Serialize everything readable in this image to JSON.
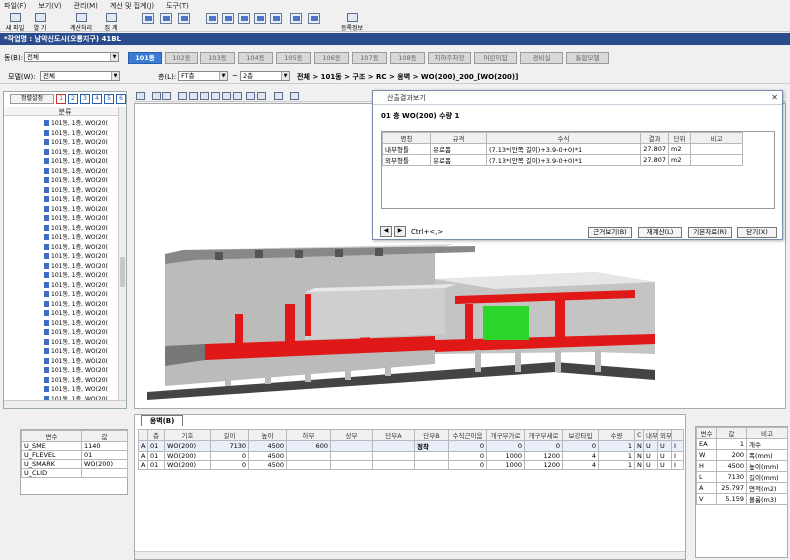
{
  "menu": [
    "파일(F)",
    "보기(V)",
    "관리(M)",
    "계산 및 집계(J)",
    "도구(T)"
  ],
  "toolbar": {
    "buttons": [
      "새 파일",
      "열 기",
      "계산처리",
      "집 계",
      "등록정보"
    ]
  },
  "title": "*작업명 : 남악신도시(오룡지구) 41BL",
  "building_label": "동(B):",
  "building_value": "전체",
  "tabs": [
    "101동",
    "102동",
    "103동",
    "104동",
    "105동",
    "106동",
    "107동",
    "108동",
    "지하주차장",
    "어린이집",
    "경비실",
    "통합모델"
  ],
  "model_label": "모델(W):",
  "model_value": "전체",
  "floor_label": "층(L):",
  "floor_from": "FT층",
  "floor_sep": "~",
  "floor_to": "2층",
  "breadcrumb": "전체 > 101동 > 구조 > RC > 옹벽 > WO(200)_200_[WO(200)]",
  "left": {
    "sort_label": "정렬설정",
    "nums": [
      "1",
      "2",
      "3",
      "4",
      "5",
      "6"
    ],
    "col_header": "분류",
    "item_text": "101동, 1층, WO(20("
  },
  "dialog": {
    "title": "산출결과보기",
    "heading": "01 층 WO(200)  수량 1",
    "columns": [
      "명칭",
      "규격",
      "수식",
      "결과",
      "단위",
      "비고"
    ],
    "rows": [
      [
        "내부형틀",
        "유로폼",
        "(7.13*(안쪽 길이)+3.9-0+0)*1",
        "27.807",
        "m2",
        ""
      ],
      [
        "외부형틀",
        "유로폼",
        "(7.13*(안쪽 길이)+3.9-0+0)*1",
        "27.807",
        "m2",
        ""
      ]
    ],
    "nav_hint": "Ctrl+<,>",
    "buttons": [
      "근거보기(B)",
      "재계산(L)",
      "기본자료(R)",
      "닫기(X)"
    ]
  },
  "vars": {
    "columns": [
      "변수",
      "값"
    ],
    "rows": [
      [
        "U_SME",
        "1140"
      ],
      [
        "U_FLEVEL",
        "01"
      ],
      [
        "U_SMARK",
        "WO(200)"
      ],
      [
        "U_CLID",
        ""
      ]
    ]
  },
  "bottom": {
    "tab": "옹벽(B)",
    "columns": [
      "",
      "층",
      "기호",
      "길이",
      "높이",
      "하부",
      "상부",
      "단부A",
      "단부B",
      "수직근이음",
      "개구부가로",
      "개구부세로",
      "보강타입",
      "수량",
      "C",
      "내부",
      "외부",
      ""
    ],
    "rows": [
      [
        "A",
        "01",
        "WO(200)",
        "7130",
        "4500",
        "600",
        "",
        "",
        "정착",
        "0",
        "0",
        "0",
        "0",
        "1",
        "N",
        "U",
        "U",
        "I"
      ],
      [
        "A",
        "01",
        "WO(200)",
        "0",
        "4500",
        "",
        "",
        "",
        "",
        "0",
        "1000",
        "1200",
        "4",
        "1",
        "N",
        "U",
        "U",
        "I"
      ],
      [
        "A",
        "01",
        "WO(200)",
        "0",
        "4500",
        "",
        "",
        "",
        "",
        "0",
        "1000",
        "1200",
        "4",
        "1",
        "N",
        "U",
        "U",
        "I"
      ]
    ]
  },
  "right": {
    "columns": [
      "변수",
      "값",
      "비고"
    ],
    "rows": [
      [
        "EA",
        "1",
        "개수"
      ],
      [
        "W",
        "200",
        "폭(mm)"
      ],
      [
        "H",
        "4500",
        "높이(mm)"
      ],
      [
        "L",
        "7130",
        "길이(mm)"
      ],
      [
        "A",
        "25.797",
        "면적(m2)"
      ],
      [
        "V",
        "5.159",
        "볼륨(m3)"
      ]
    ]
  }
}
